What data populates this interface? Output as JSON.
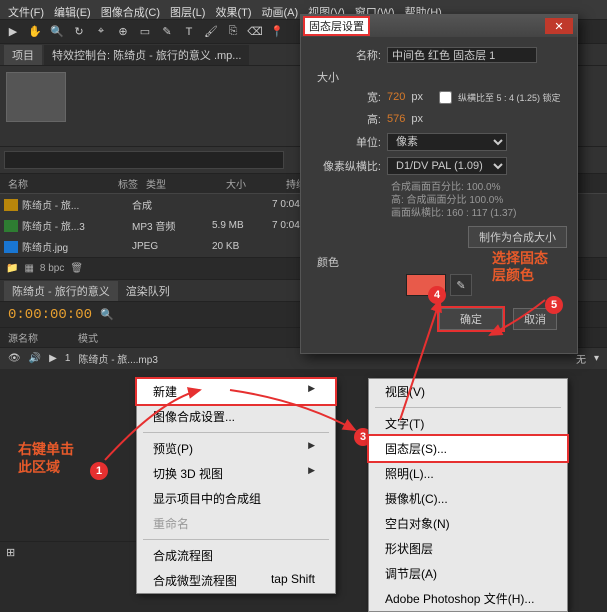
{
  "menubar": [
    "文件(F)",
    "编辑(E)",
    "图像合成(C)",
    "图层(L)",
    "效果(T)",
    "动画(A)",
    "视图(V)",
    "窗口(W)",
    "帮助(H)"
  ],
  "panel": {
    "tab_project": "项目",
    "tab_fx": "特效控制台: 陈绮贞 - 旅行的意义 .mp..."
  },
  "search": {
    "placeholder": ""
  },
  "list_header": {
    "name": "名称",
    "tag": "标签",
    "type": "类型",
    "size": "大小",
    "duration": "持续时间"
  },
  "files": [
    {
      "name": "陈绮贞 - 旅...",
      "type": "合成",
      "size": "",
      "dur": "7 0:04"
    },
    {
      "name": "陈绮贞 - 旅...3",
      "type": "MP3 音频",
      "size": "5.9 MB",
      "dur": "7 0:04"
    },
    {
      "name": "陈绮贞.jpg",
      "type": "JPEG",
      "size": "20 KB",
      "dur": ""
    }
  ],
  "project_footer": {
    "bpc": "8 bpc"
  },
  "timeline": {
    "tab1": "陈绮贞 - 旅行的意义",
    "tab2": "渲染队列",
    "timecode": "0:00:00:00",
    "col_src": "源名称",
    "col_mode": "模式",
    "layer1": "陈绮贞 - 旅....mp3",
    "layer_num": "1",
    "mode_none": "无"
  },
  "hint1_l1": "右键单击",
  "hint1_l2": "此区域",
  "hint2_l1": "选择固态",
  "hint2_l2": "层颜色",
  "menu1": {
    "new": "新建",
    "comp": "图像合成设置...",
    "preview": "预览(P)",
    "switch3d": "切换 3D 视图",
    "reveal": "显示项目中的合成组",
    "rename": "重命名",
    "flow": "合成流程图",
    "miniFlow": "合成微型流程图",
    "miniFlowKey": "tap Shift"
  },
  "menu2": {
    "viewer": "视图(V)",
    "text": "文字(T)",
    "solid": "固态层(S)...",
    "light": "照明(L)...",
    "camera": "摄像机(C)...",
    "null": "空白对象(N)",
    "shape": "形状图层",
    "adjust": "调节层(A)",
    "ps": "Adobe Photoshop 文件(H)..."
  },
  "dialog": {
    "title": "固态层设置",
    "name_label": "名称:",
    "name_value": "中间色 红色 固态层 1",
    "size_header": "大小",
    "width_label": "宽:",
    "width_value": "720",
    "width_unit": "px",
    "lock_label": "纵横比至 5 : 4 (1.25) 锁定",
    "height_label": "高:",
    "height_value": "576",
    "height_unit": "px",
    "unit_label": "单位:",
    "unit_value": "像素",
    "par_label": "像素纵横比:",
    "par_value": "D1/DV PAL (1.09)",
    "info1": "合成画面百分比: 100.0%",
    "info2": "高: 合成画面分比 100.0%",
    "info3": "画面纵横比: 160 : 117 (1.37)",
    "make_comp": "制作为合成大小",
    "color_label": "颜色",
    "ok": "确定",
    "cancel": "取消"
  }
}
